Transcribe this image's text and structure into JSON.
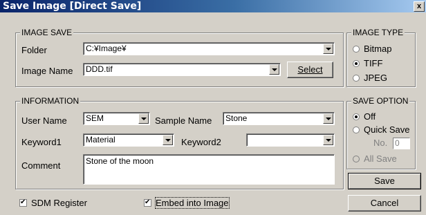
{
  "window": {
    "title": "Save Image [Direct Save]",
    "close_label": "x"
  },
  "image_save": {
    "group_label": "IMAGE SAVE",
    "folder_label": "Folder",
    "folder_value": "C:¥Image¥",
    "image_name_label": "Image Name",
    "image_name_value": "DDD.tif",
    "select_label": "Select"
  },
  "image_type": {
    "group_label": "IMAGE TYPE",
    "options": [
      {
        "label": "Bitmap",
        "selected": false
      },
      {
        "label": "TIFF",
        "selected": true
      },
      {
        "label": "JPEG",
        "selected": false
      }
    ]
  },
  "information": {
    "group_label": "INFORMATION",
    "user_name_label": "User Name",
    "user_name_value": "SEM",
    "sample_name_label": "Sample Name",
    "sample_name_value": "Stone",
    "keyword1_label": "Keyword1",
    "keyword1_value": "Material",
    "keyword2_label": "Keyword2",
    "keyword2_value": "",
    "comment_label": "Comment",
    "comment_value": "Stone of the moon"
  },
  "save_option": {
    "group_label": "SAVE OPTION",
    "off_label": "Off",
    "quick_save_label": "Quick Save",
    "no_label": "No.",
    "no_value": "0",
    "all_save_label": "All Save",
    "selected": "Off"
  },
  "buttons": {
    "save_label": "Save",
    "cancel_label": "Cancel"
  },
  "checkboxes": {
    "sdm_register_label": "SDM Register",
    "sdm_register_checked": true,
    "embed_label": "Embed into Image",
    "embed_checked": true
  }
}
